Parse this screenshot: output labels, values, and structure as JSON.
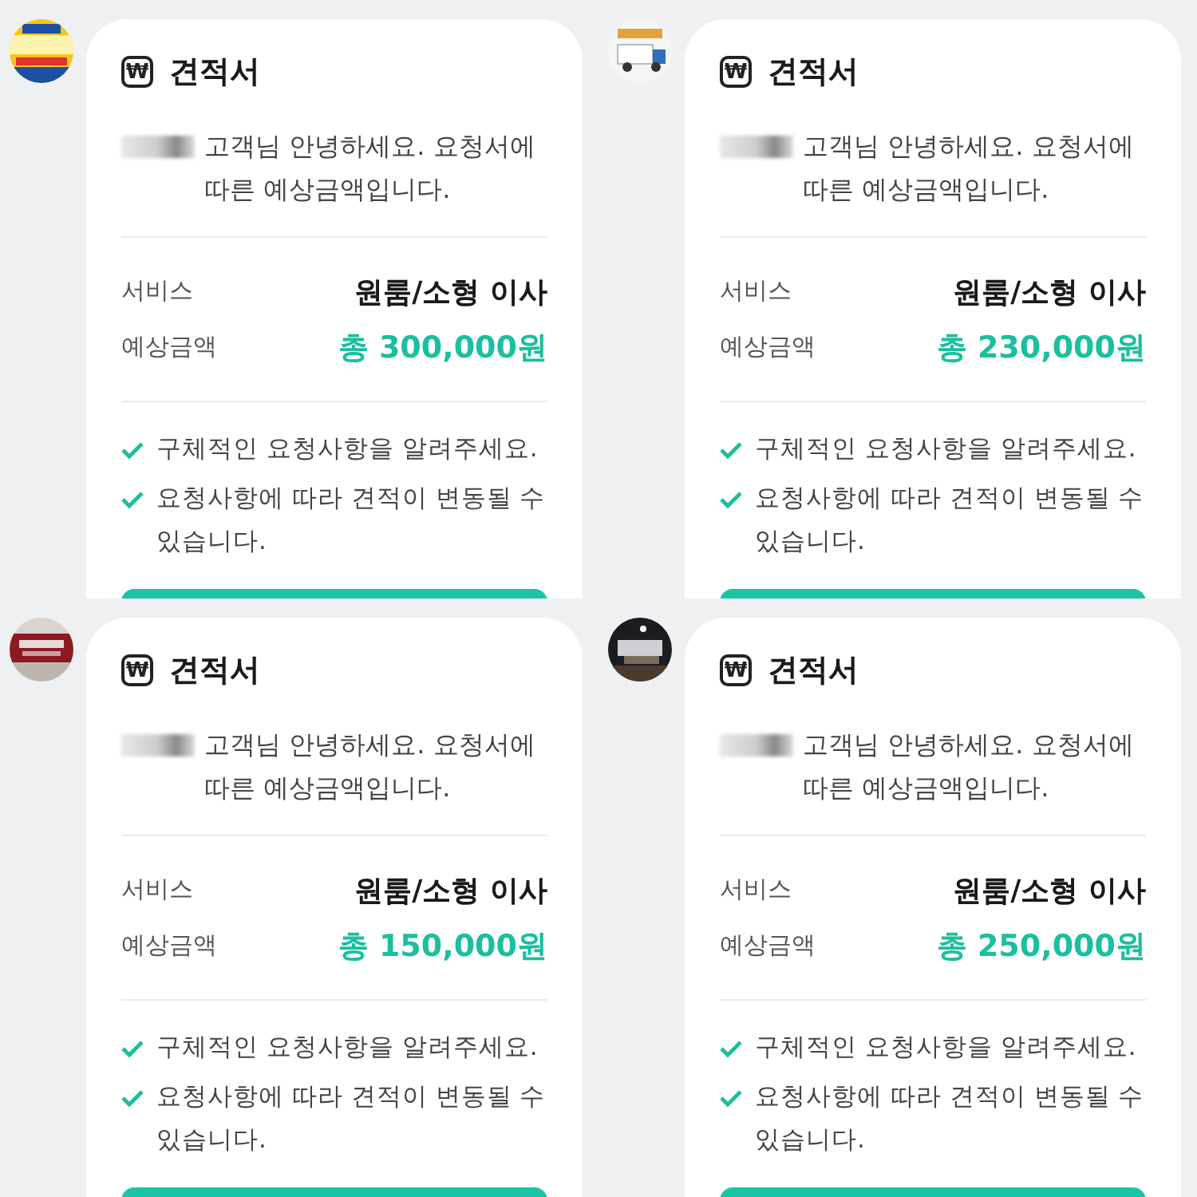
{
  "panels": [
    {
      "card": {
        "icon_glyph": "₩",
        "title": "견적서",
        "greeting": "고객님 안녕하세요. 요청서에 따른 예상금액입니다.",
        "details": [
          {
            "kind": "service",
            "label": "서비스",
            "value": "원룸/소형 이사"
          },
          {
            "kind": "price",
            "label": "예상금액",
            "value": "총 300,000원"
          }
        ],
        "notes": [
          "구체적인 요청사항을 알려주세요.",
          "요청사항에 따라 견적이 변동될 수 있습니다."
        ]
      }
    },
    {
      "card": {
        "icon_glyph": "₩",
        "title": "견적서",
        "greeting": "고객님 안녕하세요. 요청서에 따른 예상금액입니다.",
        "details": [
          {
            "kind": "service",
            "label": "서비스",
            "value": "원룸/소형 이사"
          },
          {
            "kind": "price",
            "label": "예상금액",
            "value": "총 230,000원"
          }
        ],
        "notes": [
          "구체적인 요청사항을 알려주세요.",
          "요청사항에 따라 견적이 변동될 수 있습니다."
        ]
      }
    },
    {
      "card": {
        "icon_glyph": "₩",
        "title": "견적서",
        "greeting": "고객님 안녕하세요. 요청서에 따른 예상금액입니다.",
        "details": [
          {
            "kind": "service",
            "label": "서비스",
            "value": "원룸/소형 이사"
          },
          {
            "kind": "price",
            "label": "예상금액",
            "value": "총 150,000원"
          }
        ],
        "notes": [
          "구체적인 요청사항을 알려주세요.",
          "요청사항에 따라 견적이 변동될 수 있습니다."
        ]
      }
    },
    {
      "card": {
        "icon_glyph": "₩",
        "title": "견적서",
        "greeting": "고객님 안녕하세요. 요청서에 따른 예상금액입니다.",
        "details": [
          {
            "kind": "service",
            "label": "서비스",
            "value": "원룸/소형 이사"
          },
          {
            "kind": "price",
            "label": "예상금액",
            "value": "총 250,000원"
          }
        ],
        "notes": [
          "구체적인 요청사항을 알려주세요.",
          "요청사항에 따라 견적이 변동될 수 있습니다."
        ]
      }
    }
  ]
}
